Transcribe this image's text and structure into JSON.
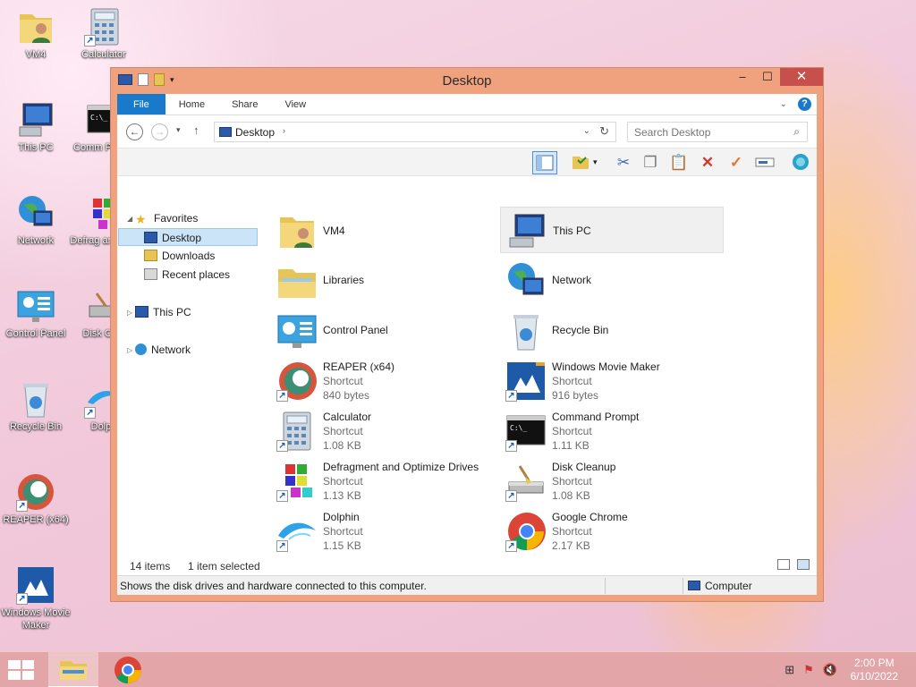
{
  "desktop": {
    "icons": [
      {
        "label": "VM4"
      },
      {
        "label": "Calculator"
      },
      {
        "label": "This PC"
      },
      {
        "label": "Comm Promp"
      },
      {
        "label": "Network"
      },
      {
        "label": "Defrag and Opt"
      },
      {
        "label": "Control Panel"
      },
      {
        "label": "Disk Clea"
      },
      {
        "label": "Recycle Bin"
      },
      {
        "label": "Dolph"
      },
      {
        "label": "REAPER (x64)"
      },
      {
        "label": "Windows Movie Maker"
      }
    ]
  },
  "window": {
    "title": "Desktop",
    "ribbon_tabs": [
      "File",
      "Home",
      "Share",
      "View"
    ],
    "help": "?",
    "address": {
      "location": "Desktop",
      "chevron": "›"
    },
    "search": {
      "placeholder": "Search Desktop"
    },
    "nav_pane": {
      "favorites": "Favorites",
      "desktop": "Desktop",
      "downloads": "Downloads",
      "recent": "Recent places",
      "this_pc": "This PC",
      "network": "Network"
    },
    "items": [
      {
        "name": "VM4",
        "type": "",
        "size": ""
      },
      {
        "name": "This PC",
        "type": "",
        "size": ""
      },
      {
        "name": "Libraries",
        "type": "",
        "size": ""
      },
      {
        "name": "Network",
        "type": "",
        "size": ""
      },
      {
        "name": "Control Panel",
        "type": "",
        "size": ""
      },
      {
        "name": "Recycle Bin",
        "type": "",
        "size": ""
      },
      {
        "name": "REAPER (x64)",
        "type": "Shortcut",
        "size": "840 bytes"
      },
      {
        "name": "Windows Movie Maker",
        "type": "Shortcut",
        "size": "916 bytes"
      },
      {
        "name": "Calculator",
        "type": "Shortcut",
        "size": "1.08 KB"
      },
      {
        "name": "Command Prompt",
        "type": "Shortcut",
        "size": "1.11 KB"
      },
      {
        "name": "Defragment and Optimize Drives",
        "type": "Shortcut",
        "size": "1.13 KB"
      },
      {
        "name": "Disk Cleanup",
        "type": "Shortcut",
        "size": "1.08 KB"
      },
      {
        "name": "Dolphin",
        "type": "Shortcut",
        "size": "1.15 KB"
      },
      {
        "name": "Google Chrome",
        "type": "Shortcut",
        "size": "2.17 KB"
      }
    ],
    "status": {
      "count": "14 items",
      "selected": "1 item selected"
    },
    "infobar": {
      "message": "Shows the disk drives and hardware connected to this computer.",
      "location": "Computer"
    }
  },
  "taskbar": {
    "time": "2:00 PM",
    "date": "6/10/2022"
  },
  "colors": {
    "accent": "#1979ca",
    "window_frame": "#f0a17d",
    "close": "#c7504d",
    "selection": "#cce4f7"
  }
}
